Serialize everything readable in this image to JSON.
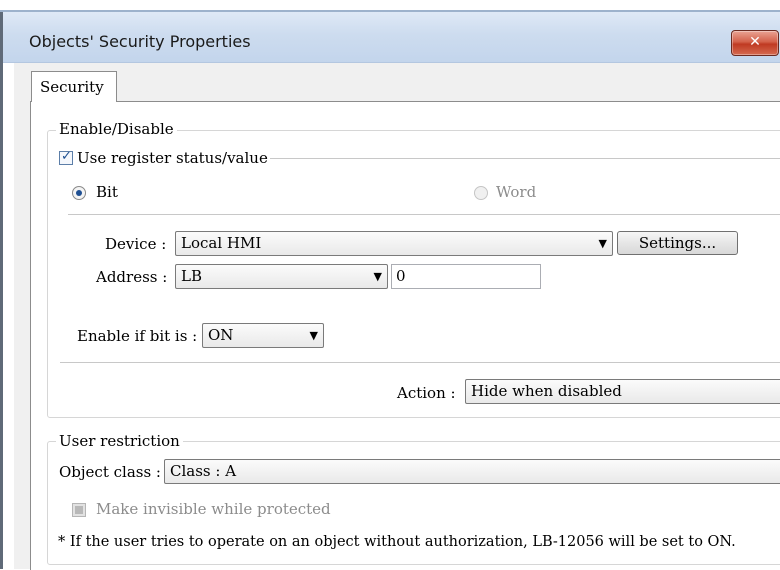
{
  "window": {
    "title": "Objects' Security Properties",
    "close_glyph": "✕",
    "accent_color": "#c3d5ec",
    "close_color": "#c8432b"
  },
  "tabs": [
    {
      "label": "Security",
      "active": true
    }
  ],
  "enable_disable": {
    "legend": "Enable/Disable",
    "use_register": {
      "label": "Use register status/value",
      "checked": true
    },
    "bit_radio": {
      "label": "Bit",
      "selected": true
    },
    "word_radio": {
      "label": "Word",
      "selected": false,
      "enabled": false
    },
    "device": {
      "label": "Device :",
      "value": "Local HMI"
    },
    "settings_button": "Settings...",
    "address": {
      "label": "Address :",
      "type_value": "LB",
      "number_value": "0"
    },
    "enable_if": {
      "label": "Enable if bit is :",
      "value": "ON"
    },
    "action": {
      "label": "Action :",
      "value": "Hide when disabled"
    }
  },
  "user_restriction": {
    "legend": "User restriction",
    "object_class": {
      "label": "Object class :",
      "value": "Class : A"
    },
    "make_invisible": {
      "label": "Make invisible while protected",
      "checked": false,
      "enabled": false
    },
    "note": "* If the user tries to operate on an object without authorization, LB-12056 will be set to ON."
  },
  "icons": {
    "dropdown_arrow": "▼",
    "checkmark": "✓"
  }
}
